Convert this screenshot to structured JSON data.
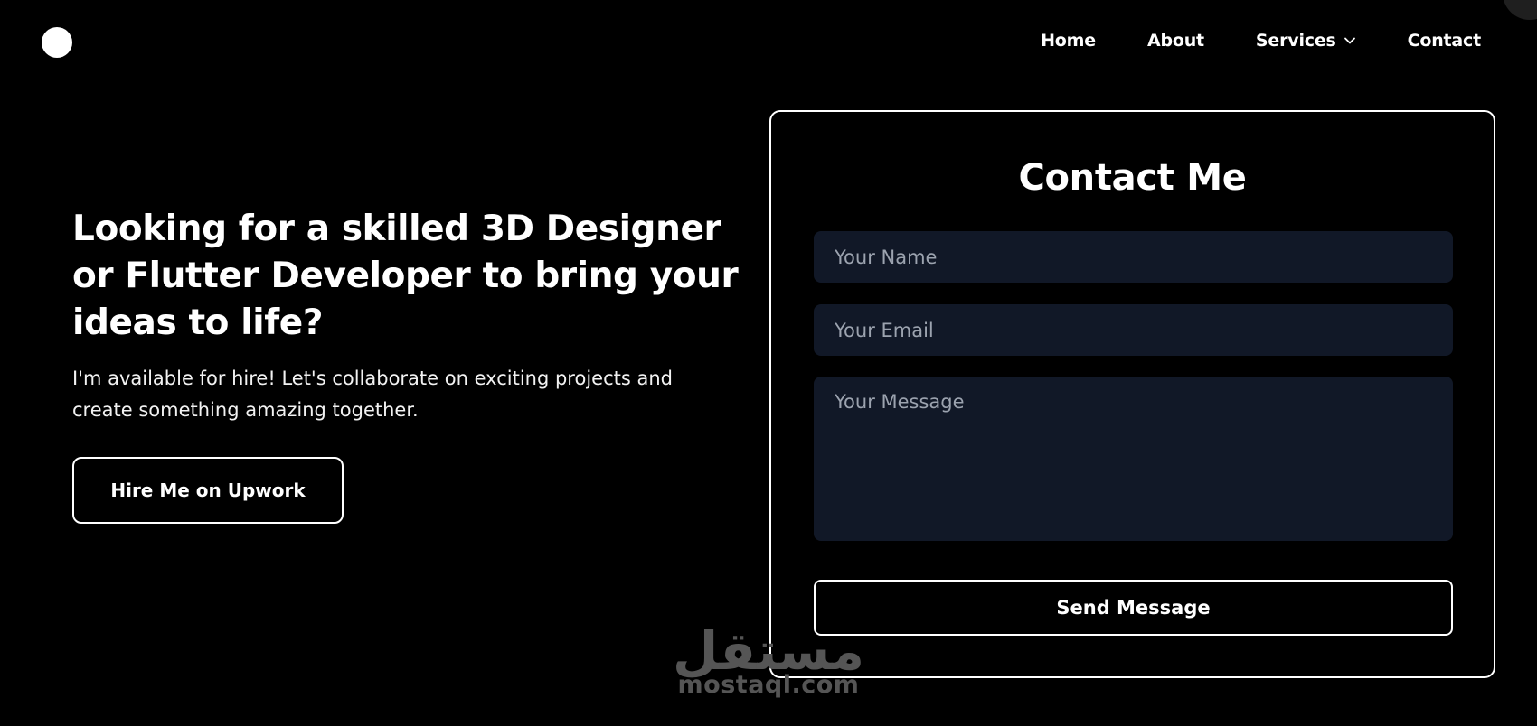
{
  "nav": {
    "items": [
      {
        "label": "Home"
      },
      {
        "label": "About"
      },
      {
        "label": "Services"
      },
      {
        "label": "Contact"
      }
    ]
  },
  "hero": {
    "title": "Looking for a skilled 3D Designer or Flutter Developer to bring your ideas to life?",
    "subtitle": "I'm available for hire! Let's collaborate on exciting projects and create something amazing together.",
    "cta_label": "Hire Me on Upwork"
  },
  "contact": {
    "title": "Contact Me",
    "name_placeholder": "Your Name",
    "email_placeholder": "Your Email",
    "message_placeholder": "Your Message",
    "submit_label": "Send Message"
  },
  "watermark": {
    "arabic": "مستقل",
    "latin": "mostaql.com"
  },
  "icons": {
    "services_dropdown": "chevron-down-icon"
  },
  "colors": {
    "background": "#000000",
    "foreground": "#ffffff",
    "field_background": "#111827",
    "placeholder": "#9ca3af"
  }
}
